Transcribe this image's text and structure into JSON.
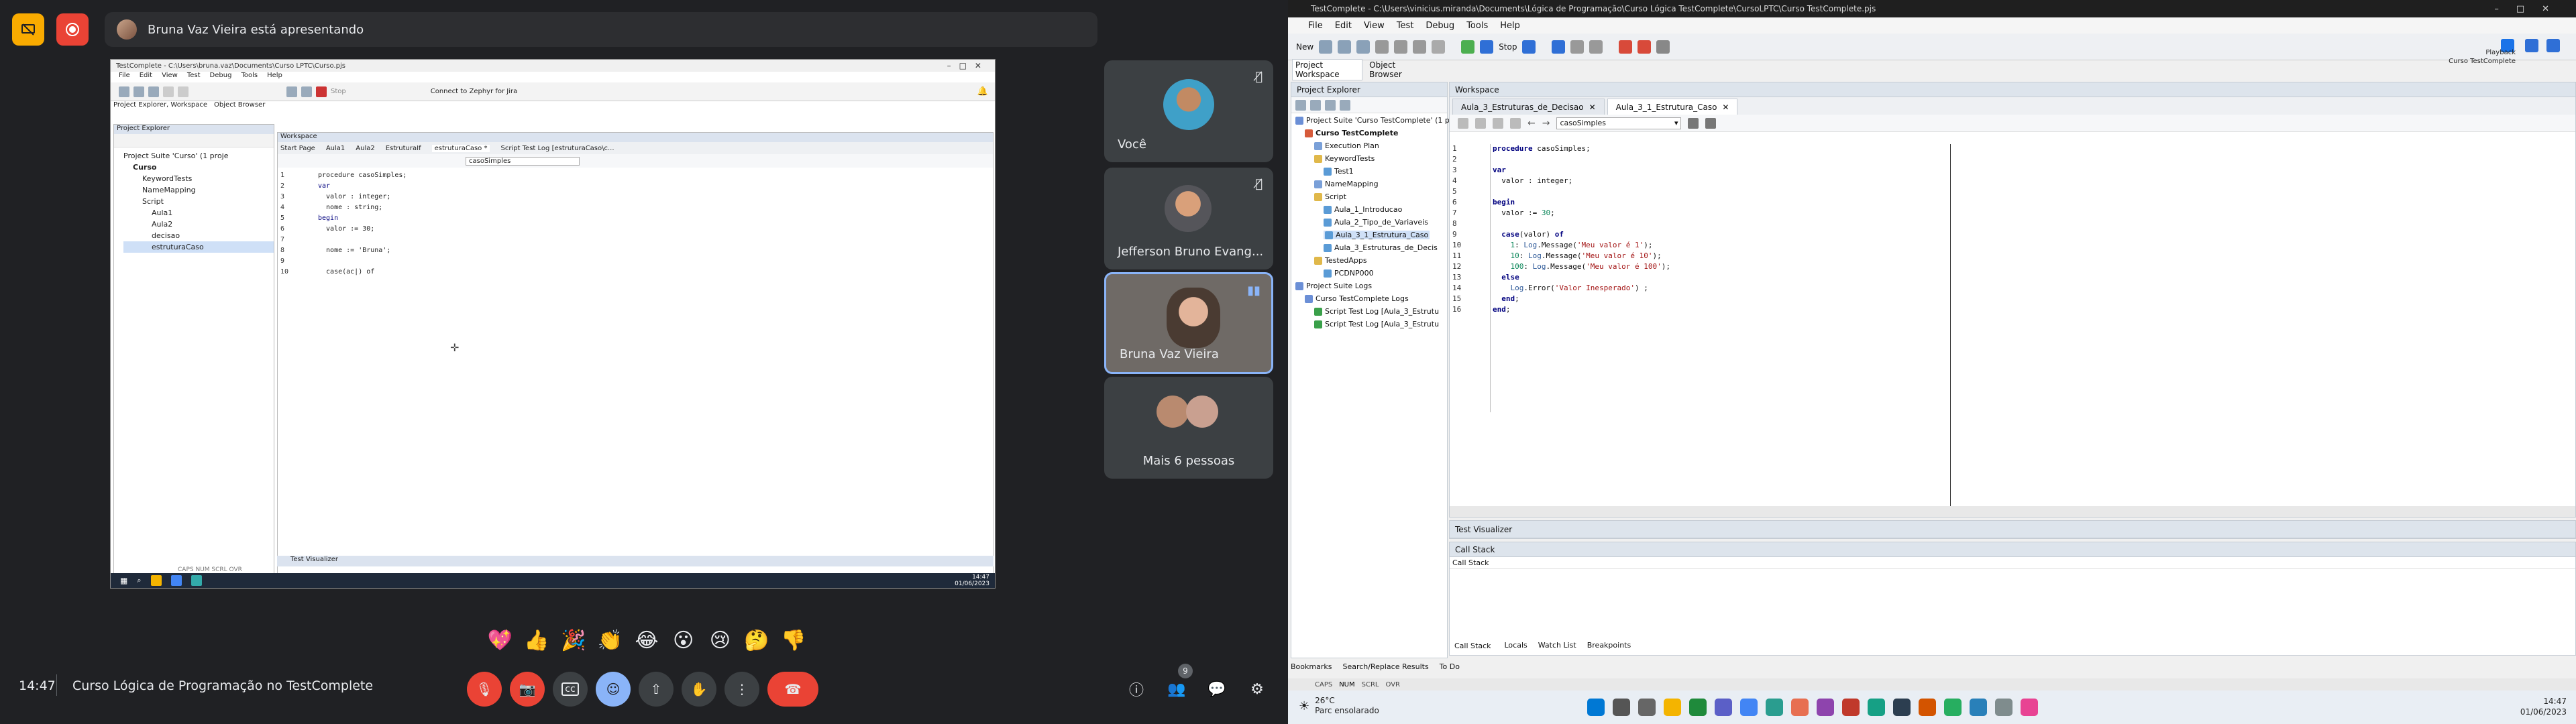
{
  "meet": {
    "presenter_banner": "Bruna Vaz Vieira está apresentando",
    "time": "14:47",
    "meeting_title": "Curso Lógica de Programação no TestComplete",
    "participants_count": "9",
    "tiles": [
      {
        "name": "Você"
      },
      {
        "name": "Jefferson Bruno Evang..."
      },
      {
        "name": "Bruna Vaz Vieira"
      },
      {
        "name": "Mais 6 pessoas"
      }
    ],
    "reactions": [
      "💖",
      "👍",
      "🎉",
      "👏",
      "😂",
      "😮",
      "😢",
      "🤔",
      "👎"
    ],
    "colors": {
      "end_call": "#ea4335",
      "record": "#ea4335",
      "present": "#f9ab00",
      "self_view": "#8ab4f8"
    }
  },
  "shared": {
    "title": "TestComplete - C:\\Users\\bruna.vaz\\Documents\\Curso LPTC\\Curso.pjs",
    "menu": [
      "File",
      "Edit",
      "View",
      "Test",
      "Debug",
      "Tools",
      "Help"
    ],
    "connect_label": "Connect to  Zephyr for Jira",
    "stop_label": "Stop",
    "workspace_tabs": [
      "Project Explorer, Workspace",
      "Object Browser"
    ],
    "project_explorer_title": "Project Explorer",
    "workspace_title": "Workspace",
    "editor_tabs": [
      "Start Page",
      "Aula1",
      "Aula2",
      "EstruturaIf",
      "estruturaCaso *",
      "Script Test Log [estruturaCaso\\c..."
    ],
    "routine_select": "casoSimples",
    "tree": [
      "Project Suite 'Curso' (1 proje",
      "Curso",
      "KeywordTests",
      "NameMapping",
      "Script",
      "Aula1",
      "Aula2",
      "decisao",
      "estruturaCaso"
    ],
    "code": [
      "procedure casoSimples;",
      "var",
      "  valor : integer;",
      "  nome : string;",
      "begin",
      "  valor := 30;",
      "",
      "  nome := 'Bruna';",
      "",
      "  case(ac|) of"
    ],
    "test_visualizer": "Test Visualizer",
    "status": "CAPS  NUM  SCRL  OVR",
    "taskbar_time": "14:47",
    "taskbar_date": "01/06/2023"
  },
  "tc": {
    "title": "TestComplete - C:\\Users\\vinicius.miranda\\Documents\\Lógica de Programação\\Curso Lógica TestComplete\\CursoLPTC\\Curso TestComplete.pjs",
    "menu": [
      "File",
      "Edit",
      "View",
      "Test",
      "Debug",
      "Tools",
      "Help"
    ],
    "new_label": "New",
    "stop_label": "Stop",
    "workspace_tabs": [
      "Project Workspace",
      "Object Browser"
    ],
    "project_explorer_title": "Project Explorer",
    "workspace_title": "Workspace",
    "tree": [
      {
        "label": "Project Suite 'Curso TestComplete' (1 pro",
        "depth": 0,
        "color": "#6b8fd6"
      },
      {
        "label": "Curso TestComplete",
        "depth": 1,
        "color": "#d65a3a",
        "bold": true
      },
      {
        "label": "Execution Plan",
        "depth": 2,
        "color": "#7aa0d8"
      },
      {
        "label": "KeywordTests",
        "depth": 2,
        "color": "#e0b84a"
      },
      {
        "label": "Test1",
        "depth": 3,
        "color": "#5a9bd6"
      },
      {
        "label": "NameMapping",
        "depth": 2,
        "color": "#7aa0d8"
      },
      {
        "label": "Script",
        "depth": 2,
        "color": "#e0b84a"
      },
      {
        "label": "Aula_1_Introducao",
        "depth": 3,
        "color": "#5a9bd6"
      },
      {
        "label": "Aula_2_Tipo_de_Variaveis",
        "depth": 3,
        "color": "#5a9bd6"
      },
      {
        "label": "Aula_3_1_Estrutura_Caso",
        "depth": 3,
        "color": "#5a9bd6",
        "selected": true
      },
      {
        "label": "Aula_3_Estruturas_de_Decis",
        "depth": 3,
        "color": "#5a9bd6"
      },
      {
        "label": "TestedApps",
        "depth": 2,
        "color": "#e0b84a"
      },
      {
        "label": "PCDNP000",
        "depth": 3,
        "color": "#5a9bd6"
      },
      {
        "label": "Project Suite Logs",
        "depth": 0,
        "color": "#6b8fd6"
      },
      {
        "label": "Curso TestComplete Logs",
        "depth": 1,
        "color": "#6b8fd6"
      },
      {
        "label": "Script Test Log [Aula_3_Estrutu",
        "depth": 2,
        "color": "#3aa04a"
      },
      {
        "label": "Script Test Log [Aula_3_Estrutu",
        "depth": 2,
        "color": "#3aa04a"
      }
    ],
    "editor_tabs": [
      "Aula_3_Estruturas_de_Decisao",
      "Aula_3_1_Estrutura_Caso"
    ],
    "routine_select": "casoSimples",
    "line_numbers": [
      "1",
      "2",
      "3",
      "4",
      "5",
      "6",
      "7",
      "8",
      "9",
      "10",
      "11",
      "12",
      "13",
      "14",
      "15",
      "16"
    ],
    "test_visualizer": "Test Visualizer",
    "call_stack_title": "Call Stack",
    "call_stack_header": "Call Stack",
    "bottom_tabs": [
      "Call Stack",
      "Locals",
      "Watch List",
      "Breakpoints"
    ],
    "left_bottom_tabs": [
      "Bookmarks",
      "Search/Replace Results",
      "To Do"
    ],
    "status": [
      "CAPS",
      "NUM",
      "SCRL",
      "OVR"
    ],
    "playback_tip_1": "Playback",
    "playback_tip_2": "Curso TestComplete",
    "weather_temp": "26°C",
    "weather_desc": "Parc ensolarado",
    "clock_time": "14:47",
    "clock_date": "01/06/2023"
  }
}
